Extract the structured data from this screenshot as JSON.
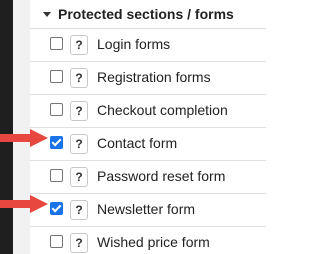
{
  "section": {
    "title": "Protected sections / forms",
    "expanded": true
  },
  "items": [
    {
      "label": "Login forms",
      "checked": false,
      "help": "?"
    },
    {
      "label": "Registration forms",
      "checked": false,
      "help": "?"
    },
    {
      "label": "Checkout completion",
      "checked": false,
      "help": "?"
    },
    {
      "label": "Contact form",
      "checked": true,
      "help": "?"
    },
    {
      "label": "Password reset form",
      "checked": false,
      "help": "?"
    },
    {
      "label": "Newsletter form",
      "checked": true,
      "help": "?"
    },
    {
      "label": "Wished price form",
      "checked": false,
      "help": "?"
    }
  ],
  "colors": {
    "arrow": "#e8473f",
    "checkbox_checked": "#1a73e8"
  },
  "icons": {
    "caret": "caret-down-icon",
    "help": "question-mark-icon",
    "annotation": "red-arrow-icon"
  }
}
